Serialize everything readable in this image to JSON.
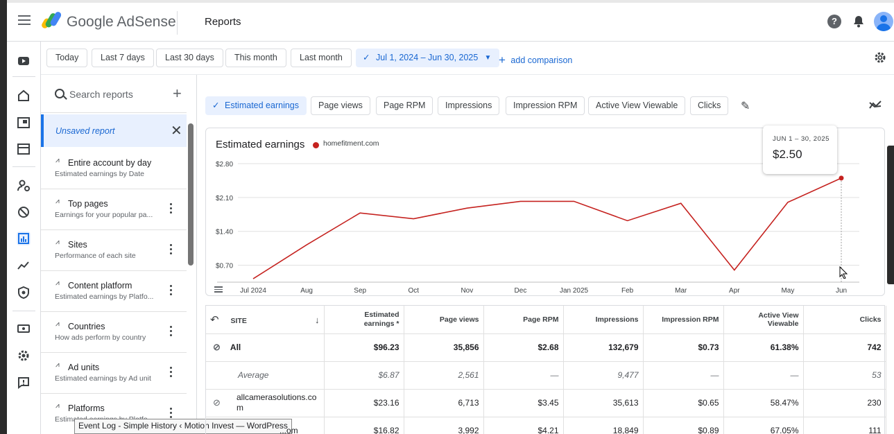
{
  "app": {
    "brand": "Google AdSense",
    "page_title": "Reports",
    "help_glyph": "?",
    "brand_colors": [
      "#fbbc04",
      "#34a853",
      "#4285f4"
    ]
  },
  "filters": {
    "today": "Today",
    "last7": "Last 7 days",
    "last30": "Last 30 days",
    "this_month": "This month",
    "last_month": "Last month",
    "date_range": "Jul 1, 2024 – Jun 30, 2025",
    "add_comparison": "add comparison"
  },
  "sidebar": {
    "search_placeholder": "Search reports",
    "unsaved": "Unsaved report",
    "items": [
      {
        "title": "Entire account by day",
        "sub": "Estimated earnings by Date"
      },
      {
        "title": "Top pages",
        "sub": "Earnings for your popular pa..."
      },
      {
        "title": "Sites",
        "sub": "Performance of each site"
      },
      {
        "title": "Content platform",
        "sub": "Estimated earnings by Platfo..."
      },
      {
        "title": "Countries",
        "sub": "How ads perform by country"
      },
      {
        "title": "Ad units",
        "sub": "Estimated earnings by Ad unit"
      },
      {
        "title": "Platforms",
        "sub": "Estimated earnings by Platfo..."
      }
    ]
  },
  "tooltip_window": "Event Log - Simple History ‹ Motion Invest — WordPress",
  "metrics": [
    "Estimated earnings",
    "Page views",
    "Page RPM",
    "Impressions",
    "Impression RPM",
    "Active View Viewable",
    "Clicks"
  ],
  "chart": {
    "title": "Estimated earnings",
    "legend": "homefitment.com",
    "tooltip_date": "JUN 1 – 30, 2025",
    "tooltip_value": "$2.50"
  },
  "chart_data": {
    "type": "line",
    "title": "Estimated earnings",
    "x": [
      "Jul 2024",
      "Aug",
      "Sep",
      "Oct",
      "Nov",
      "Dec",
      "Jan 2025",
      "Feb",
      "Mar",
      "Apr",
      "May",
      "Jun"
    ],
    "series": [
      {
        "name": "homefitment.com",
        "color": "#c5221f",
        "values": [
          0.42,
          1.12,
          1.78,
          1.66,
          1.88,
          2.02,
          2.02,
          1.62,
          1.98,
          0.6,
          2.0,
          2.5
        ]
      }
    ],
    "yticks": [
      "$0.70",
      "$1.40",
      "$2.10",
      "$2.80"
    ],
    "ylim": [
      0.35,
      3.1
    ],
    "grid": true,
    "legend_position": "top-left"
  },
  "table": {
    "headers": [
      "SITE",
      "Estimated earnings *",
      "Page views",
      "Page RPM",
      "Impressions",
      "Impression RPM",
      "Active View Viewable",
      "Clicks"
    ],
    "rows": [
      {
        "site": "All",
        "cells": [
          "$96.23",
          "35,856",
          "$2.68",
          "132,679",
          "$0.73",
          "61.38%",
          "742"
        ]
      },
      {
        "site": "Average",
        "cells": [
          "$6.87",
          "2,561",
          "—",
          "9,477",
          "—",
          "—",
          "53"
        ]
      },
      {
        "site": "allcamerasolutions.com",
        "cells": [
          "$23.16",
          "6,713",
          "$3.45",
          "35,613",
          "$0.65",
          "58.47%",
          "230"
        ]
      },
      {
        "site": "...om",
        "cells": [
          "$16.82",
          "3,992",
          "$4.21",
          "18,849",
          "$0.89",
          "67.05%",
          "111"
        ]
      }
    ]
  }
}
